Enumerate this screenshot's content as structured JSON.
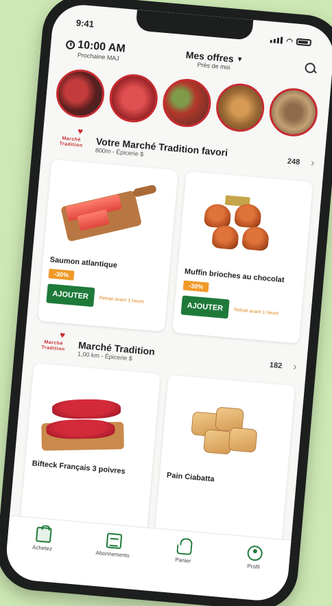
{
  "status_bar": {
    "time": "9:41"
  },
  "header": {
    "pickup_time": "10:00 AM",
    "pickup_sub": "Prochaine MAJ",
    "offers_title": "Mes offres",
    "offers_sub": "Près de moi"
  },
  "stories": [
    "story-1",
    "story-2",
    "story-3",
    "story-4",
    "story-5"
  ],
  "sections": [
    {
      "logo": "Marché Tradition",
      "title": "Votre Marché Tradition favori",
      "subtitle": "800m - Épicerie $",
      "count": "248",
      "products": [
        {
          "name": "Saumon atlantique",
          "tag": "-30%",
          "button": "AJOUTER",
          "note": "Retrait avant 1 heure"
        },
        {
          "name": "Muffin brioches au chocolat",
          "tag": "-30%",
          "button": "AJOUTER",
          "note": "Retrait avant 1 heure"
        }
      ]
    },
    {
      "logo": "Marché Tradition",
      "title": "Marché Tradition",
      "subtitle": "1,00 km - Épicerie $",
      "count": "182",
      "products": [
        {
          "name": "Bifteck Français 3 poivres"
        },
        {
          "name": "Pain Ciabatta"
        }
      ]
    }
  ],
  "tabbar": [
    {
      "label": "Achetez",
      "icon": "bag-icon"
    },
    {
      "label": "Abonnements",
      "icon": "subscriptions-icon"
    },
    {
      "label": "Panier",
      "icon": "basket-icon"
    },
    {
      "label": "Profil",
      "icon": "profile-icon"
    }
  ],
  "colors": {
    "brand_green": "#1f7a3a",
    "tag_orange": "#f09a2a",
    "accent_red": "#c62b30",
    "background": "#cde8b4"
  }
}
